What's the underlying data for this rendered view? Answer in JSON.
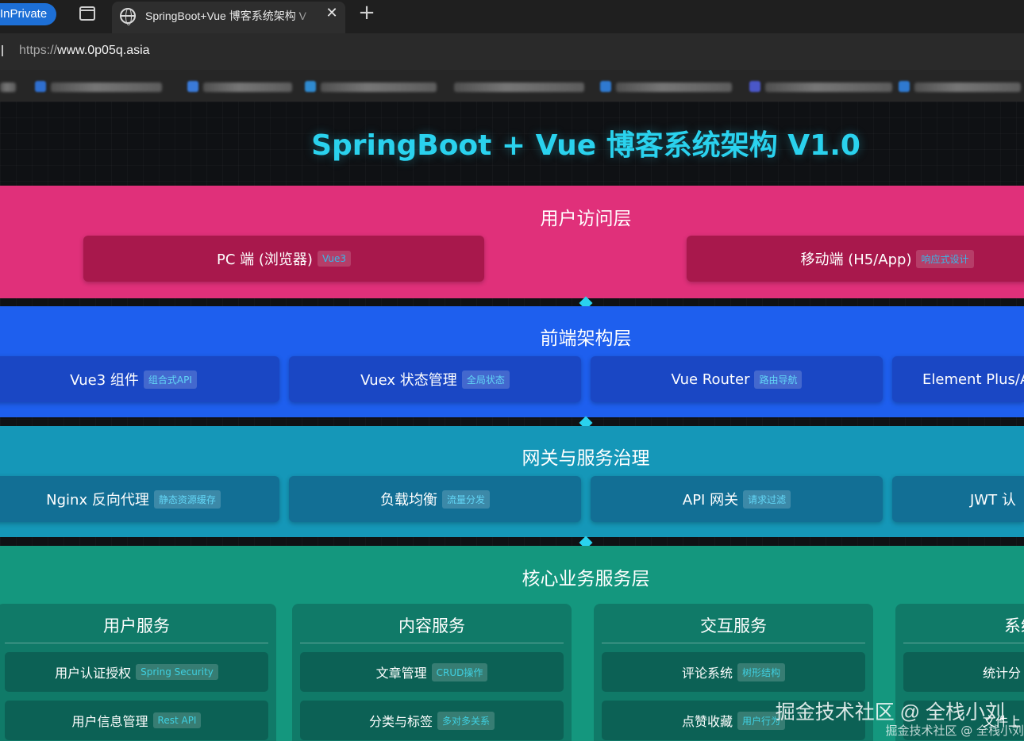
{
  "browser": {
    "inprivate_label": "InPrivate",
    "tab_title": "SpringBoot+Vue 博客系统架构 V",
    "url_protocol": "https://",
    "url_host": "www.0p05q.asia"
  },
  "page": {
    "title": "SpringBoot + Vue 博客系统架构 V1.0"
  },
  "layers": {
    "access": {
      "title": "用户访问层",
      "items": [
        {
          "label": "PC 端 (浏览器)",
          "tag": "Vue3"
        },
        {
          "label": "移动端 (H5/App)",
          "tag": "响应式设计"
        }
      ]
    },
    "frontend": {
      "title": "前端架构层",
      "items": [
        {
          "label": "Vue3 组件",
          "tag": "组合式API"
        },
        {
          "label": "Vuex 状态管理",
          "tag": "全局状态"
        },
        {
          "label": "Vue Router",
          "tag": "路由导航"
        },
        {
          "label": "Element Plus/A",
          "tag": ""
        }
      ]
    },
    "gateway": {
      "title": "网关与服务治理",
      "items": [
        {
          "label": "Nginx 反向代理",
          "tag": "静态资源缓存"
        },
        {
          "label": "负载均衡",
          "tag": "流量分发"
        },
        {
          "label": "API 网关",
          "tag": "请求过滤"
        },
        {
          "label": "JWT 认",
          "tag": ""
        }
      ]
    },
    "core": {
      "title": "核心业务服务层",
      "cards": [
        {
          "title": "用户服务",
          "items": [
            {
              "label": "用户认证授权",
              "tag": "Spring Security"
            },
            {
              "label": "用户信息管理",
              "tag": "Rest API"
            }
          ]
        },
        {
          "title": "内容服务",
          "items": [
            {
              "label": "文章管理",
              "tag": "CRUD操作"
            },
            {
              "label": "分类与标签",
              "tag": "多对多关系"
            }
          ]
        },
        {
          "title": "交互服务",
          "items": [
            {
              "label": "评论系统",
              "tag": "树形结构"
            },
            {
              "label": "点赞收藏",
              "tag": "用户行为"
            }
          ]
        },
        {
          "title": "系统",
          "items": [
            {
              "label": "统计分",
              "tag": ""
            },
            {
              "label": "文件上",
              "tag": ""
            }
          ]
        }
      ]
    }
  },
  "watermark": {
    "main": "掘金技术社区 @ 全栈小刘",
    "small": "掘金技术社区 @ 全栈小刘"
  }
}
